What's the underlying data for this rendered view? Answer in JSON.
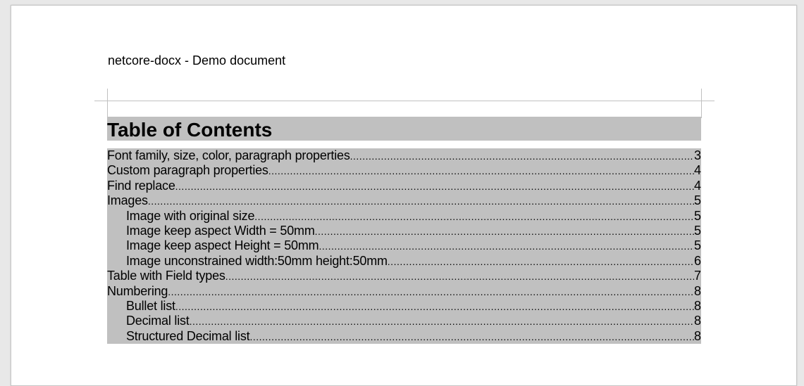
{
  "header": {
    "text": "netcore-docx - Demo document"
  },
  "toc": {
    "title": "Table of Contents",
    "entries": [
      {
        "label": "Font family, size, color, paragraph properties",
        "page": "3",
        "level": 1
      },
      {
        "label": "Custom paragraph properties",
        "page": "4",
        "level": 1
      },
      {
        "label": "Find replace",
        "page": "4",
        "level": 1
      },
      {
        "label": "Images",
        "page": "5",
        "level": 1
      },
      {
        "label": "Image with original size",
        "page": "5",
        "level": 2
      },
      {
        "label": "Image keep aspect Width = 50mm",
        "page": "5",
        "level": 2
      },
      {
        "label": "Image keep aspect Height = 50mm",
        "page": "5",
        "level": 2
      },
      {
        "label": "Image unconstrained width:50mm height:50mm",
        "page": "6",
        "level": 2
      },
      {
        "label": "Table with Field types",
        "page": "7",
        "level": 1
      },
      {
        "label": "Numbering",
        "page": "8",
        "level": 1
      },
      {
        "label": "Bullet list",
        "page": "8",
        "level": 2
      },
      {
        "label": "Decimal list",
        "page": "8",
        "level": 2
      },
      {
        "label": "Structured Decimal list",
        "page": "8",
        "level": 2
      }
    ]
  },
  "colors": {
    "field_shading": "#c0c0c0",
    "page_background": "#ffffff",
    "workspace_background": "#e8e8e8"
  }
}
